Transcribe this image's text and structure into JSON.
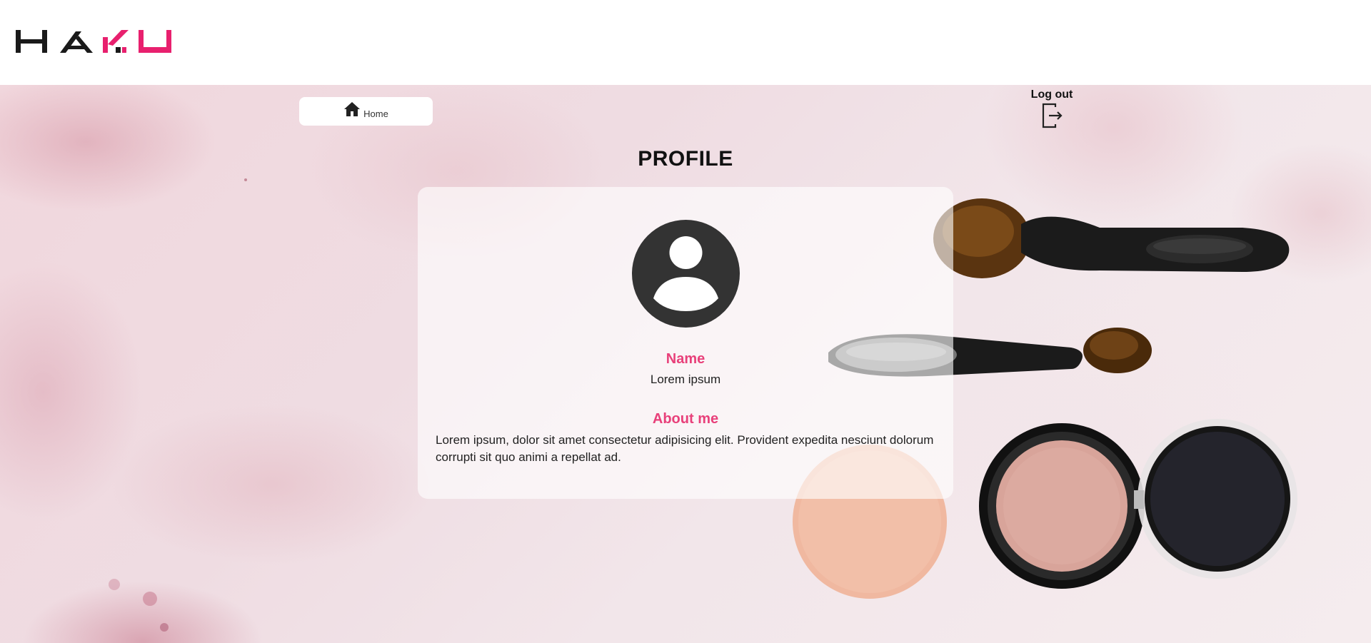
{
  "header": {
    "logo_text": "HAKU",
    "logo_colors": {
      "dark": "#1a1a1a",
      "accent": "#e8206e"
    }
  },
  "nav": {
    "home_label": "Home",
    "home_icon": "home-icon",
    "logout_label": "Log out",
    "logout_icon": "logout-icon"
  },
  "page": {
    "title": "PROFILE"
  },
  "profile": {
    "avatar_icon": "user-avatar-icon",
    "name_heading": "Name",
    "name_value": "Lorem ipsum",
    "about_heading": "About me",
    "about_text": "Lorem ipsum, dolor sit amet consectetur adipisicing elit. Provident expedita nesciunt dolorum corrupti sit quo animi a repellat ad."
  },
  "colors": {
    "accent": "#e8407a",
    "text_dark": "#111111",
    "avatar": "#333333"
  }
}
